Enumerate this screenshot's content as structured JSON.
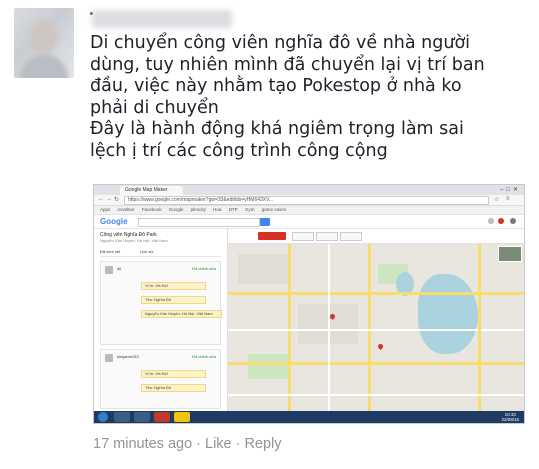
{
  "post": {
    "comment_lines": [
      "Di chuyển công viên nghĩa đô về nhà người",
      "dùng, tuy nhiên mình đã chuyển lại vị trí ban",
      "đầu, việc này nhằm tạo Pokestop ở nhà ko",
      "phải di chuyển",
      "Đây là hành động khá ngiêm trọng làm sai",
      "lệch ị trí các công trình công cộng"
    ],
    "time_ago": "17 minutes ago",
    "separator": "·",
    "like_label": "Like",
    "reply_label": "Reply"
  },
  "screenshot": {
    "browser_tab": "Google Map Maker",
    "url": "https://www.google.com/mapmaker?gw=33&editids=yHM643XV...",
    "bookmarks": [
      "Apps",
      "noveltee",
      "Facebook",
      "Google",
      "pkmcity",
      "Hoa",
      "DTP",
      "Gym",
      "game cases"
    ],
    "logo": "Google",
    "panel_title": "Công viên Nghĩa Đô Park",
    "panel_subtitle": "Nguyễn Văn Huyên, Hà Nội, Việt Nam",
    "panel_tabs": [
      "Đã xem xét",
      "Lịch sử"
    ],
    "card1_user": "dii",
    "card1_status": "Đã chỉnh sửa",
    "card1_row1": "Vị trí: Hà Nội",
    "card1_row2": "Tên: Nghĩa Đô",
    "card1_row3": "Nguyễn Văn Huyên, Hà Nội, Việt Nam",
    "card2_user": "kimjame193",
    "card2_status": "Đã chỉnh sửa",
    "card2_row1": "Vị trí: Hà Nội",
    "card2_row2": "Tên: Nghĩa Đô",
    "clock_time": "10:33",
    "clock_date": "22/08/16"
  },
  "colors": {
    "meta_text": "#90949c",
    "comment_text": "#1d2129",
    "google_blue": "#4285f4",
    "google_red": "#ea4335",
    "google_yellow": "#fbbc05",
    "google_green": "#34a853"
  }
}
